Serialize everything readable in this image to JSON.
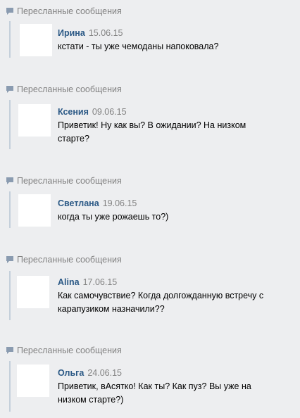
{
  "forwarded_label": "Пересланные сообщения",
  "messages": [
    {
      "author": "Ирина",
      "date": "15.06.15",
      "lines": [
        "кстати - ты уже чемоданы напоковала?"
      ]
    },
    {
      "author": "Ксения",
      "date": "09.06.15",
      "lines": [
        "Приветик! Ну как вы? В ожидании? На низком",
        "старте?"
      ]
    },
    {
      "author": "Светлана",
      "date": "19.06.15",
      "lines": [
        "когда ты уже рожаешь то?)"
      ]
    },
    {
      "author": "Alina",
      "date": "17.06.15",
      "lines": [
        "Как самочувствие? Когда долгожданную встречу с",
        "карапузиком назначили??"
      ]
    },
    {
      "author": "Ольга",
      "date": "24.06.15",
      "lines": [
        "Приветик, вАсятко! Как ты? Как пуз? Вы уже на",
        "низком старте?)"
      ]
    }
  ],
  "colors": {
    "link": "#2a5885",
    "muted": "#828282",
    "bar": "#c5d0db",
    "background": "#edeef0"
  }
}
